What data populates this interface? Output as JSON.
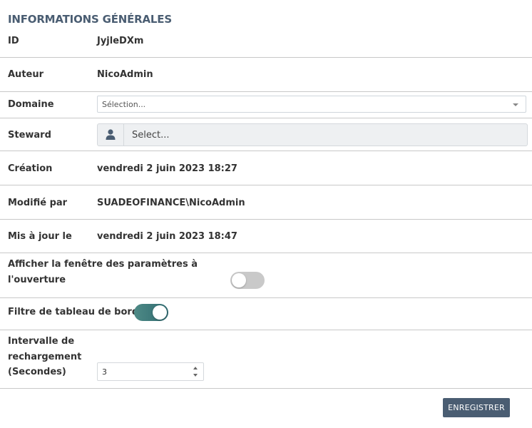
{
  "section": {
    "title": "INFORMATIONS GÉNÉRALES"
  },
  "fields": {
    "id": {
      "label": "ID",
      "value": "JyjleDXm"
    },
    "author": {
      "label": "Auteur",
      "value": "NicoAdmin"
    },
    "domain": {
      "label": "Domaine",
      "placeholder": "Sélection..."
    },
    "steward": {
      "label": "Steward",
      "placeholder": "Select...",
      "icon": "user-icon"
    },
    "creation": {
      "label": "Création",
      "value": "vendredi 2 juin 2023 18:27"
    },
    "modified_by": {
      "label": "Modifié par",
      "value": "SUADEOFINANCE\\NicoAdmin"
    },
    "updated": {
      "label": "Mis à jour le",
      "value": "vendredi 2 juin 2023 18:47"
    },
    "show_params": {
      "label_line1": "Afficher la fenêtre des paramètres à",
      "label_line2": "l'ouverture",
      "enabled": false
    },
    "dashboard_filter": {
      "label": "Filtre de tableau de bord",
      "enabled": true
    },
    "reload_interval": {
      "label_line1": "Intervalle de",
      "label_line2": "rechargement",
      "label_line3": "(Secondes)",
      "value": "3"
    }
  },
  "actions": {
    "save_label": "ENREGISTRER"
  },
  "colors": {
    "title": "#4a5d72",
    "button_bg": "#4a5d72",
    "toggle_on": "#3b7a7c",
    "toggle_off": "#c9c9c9",
    "divider": "#c8c8c8"
  }
}
